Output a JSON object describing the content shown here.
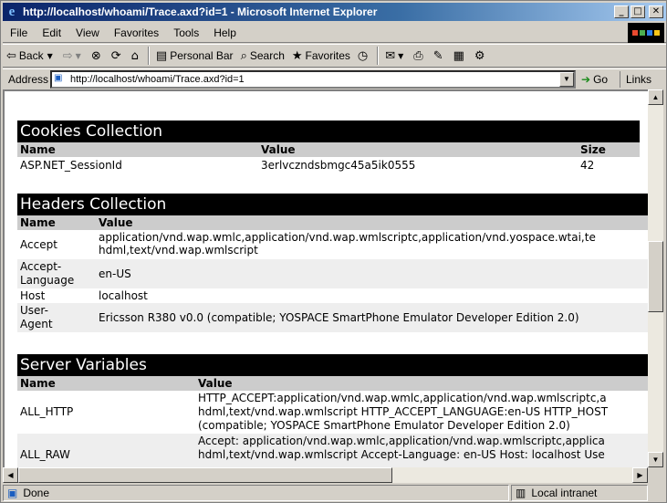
{
  "window": {
    "title": "http://localhost/whoami/Trace.axd?id=1 - Microsoft Internet Explorer"
  },
  "menu": [
    "File",
    "Edit",
    "View",
    "Favorites",
    "Tools",
    "Help"
  ],
  "toolbar": {
    "back": "Back",
    "personal_bar": "Personal Bar",
    "search": "Search",
    "favorites": "Favorites"
  },
  "address": {
    "label": "Address",
    "value": "http://localhost/whoami/Trace.axd?id=1",
    "go": "Go",
    "links": "Links"
  },
  "cookies": {
    "title": "Cookies Collection",
    "headers": [
      "Name",
      "Value",
      "Size"
    ],
    "rows": [
      [
        "ASP.NET_SessionId",
        "3erlvczndsbmgc45a5ik0555",
        "42"
      ]
    ]
  },
  "headers_collection": {
    "title": "Headers Collection",
    "headers": [
      "Name",
      "Value"
    ],
    "rows": [
      {
        "name1": "Accept",
        "name2": "",
        "v1": "application/vnd.wap.wmlc,application/vnd.wap.wmlscriptc,application/vnd.yospace.wtai,te",
        "v2": "hdml,text/vnd.wap.wmlscript"
      },
      {
        "name1": "Accept-",
        "name2": "Language",
        "v1": "en-US",
        "v2": ""
      },
      {
        "name1": "Host",
        "name2": "",
        "v1": "localhost",
        "v2": ""
      },
      {
        "name1": "User-",
        "name2": "Agent",
        "v1": "Ericsson R380 v0.0 (compatible; YOSPACE SmartPhone Emulator Developer Edition 2.0)",
        "v2": ""
      }
    ]
  },
  "server_vars": {
    "title": "Server Variables",
    "headers": [
      "Name",
      "Value"
    ],
    "rows": [
      {
        "name": "ALL_HTTP",
        "v1": "HTTP_ACCEPT:application/vnd.wap.wmlc,application/vnd.wap.wmlscriptc,a",
        "v2": "hdml,text/vnd.wap.wmlscript HTTP_ACCEPT_LANGUAGE:en-US HTTP_HOST",
        "v3": "(compatible; YOSPACE SmartPhone Emulator Developer Edition 2.0)"
      },
      {
        "name": "ALL_RAW",
        "v1": "Accept: application/vnd.wap.wmlc,application/vnd.wap.wmlscriptc,applica",
        "v2": "hdml,text/vnd.wap.wmlscript Accept-Language: en-US Host: localhost Use",
        "v3": ""
      }
    ]
  },
  "status": {
    "text": "Done",
    "zone": "Local intranet"
  }
}
